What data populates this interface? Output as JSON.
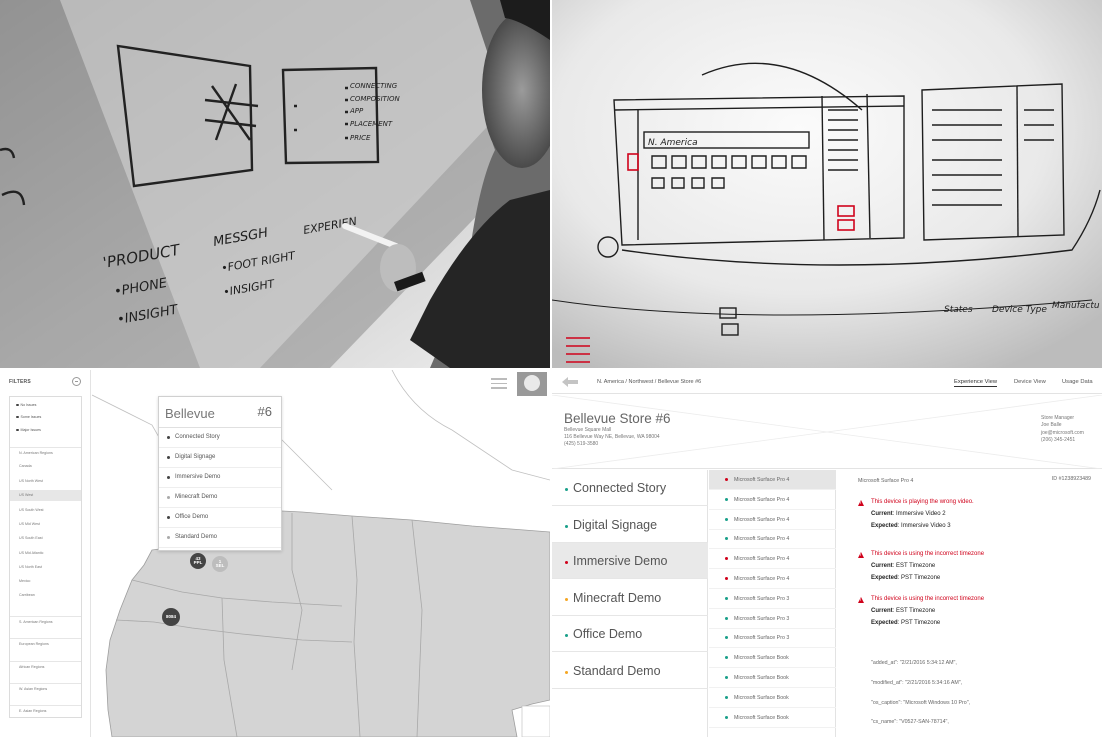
{
  "colors": {
    "alert_red": "#d0021b",
    "teal_bullet": "#1aa08a",
    "red_bullet": "#d0021b",
    "orange_bullet": "#f5a623",
    "marker_dark": "#444444",
    "marker_light": "#bdbdbd",
    "map_fill": "#d4d4d4"
  },
  "map_panel": {
    "filters": {
      "title": "FILTERS",
      "items": [
        {
          "label": "No Issues",
          "kind": "top"
        },
        {
          "label": "Some Issues",
          "kind": "top"
        },
        {
          "label": "Major Issues",
          "kind": "top"
        },
        {
          "label": "N. American Regions",
          "kind": "group"
        },
        {
          "label": "Canada",
          "kind": "sub"
        },
        {
          "label": "US North West",
          "kind": "sub"
        },
        {
          "label": "US West",
          "kind": "sub",
          "selected": true
        },
        {
          "label": "US South West",
          "kind": "sub"
        },
        {
          "label": "US Mid West",
          "kind": "sub"
        },
        {
          "label": "US South East",
          "kind": "sub"
        },
        {
          "label": "US Mid Atlantic",
          "kind": "sub"
        },
        {
          "label": "US North East",
          "kind": "sub"
        },
        {
          "label": "Mexico",
          "kind": "sub"
        },
        {
          "label": "Carribean",
          "kind": "sub"
        },
        {
          "label": "S. American Regions",
          "kind": "group"
        },
        {
          "label": "European Regions",
          "kind": "group"
        },
        {
          "label": "African Regions",
          "kind": "group"
        },
        {
          "label": "W. Asian Regions",
          "kind": "group"
        },
        {
          "label": "E. Asian Regions",
          "kind": "group"
        }
      ]
    },
    "popup": {
      "title": "Bellevue",
      "number": "#6",
      "items": [
        {
          "label": "Connected Story",
          "light": false
        },
        {
          "label": "Digital Signage",
          "light": false
        },
        {
          "label": "Immersive Demo",
          "light": false
        },
        {
          "label": "Minecraft Demo",
          "light": true
        },
        {
          "label": "Office Demo",
          "light": false
        },
        {
          "label": "Standard Demo",
          "light": true
        }
      ]
    },
    "markers": [
      {
        "line1": "43",
        "line2": "PPL",
        "style": "dark"
      },
      {
        "line1": "1",
        "line2": "SEL",
        "style": "light"
      },
      {
        "line1": "8084",
        "line2": "",
        "style": "dark"
      }
    ]
  },
  "detail_panel": {
    "breadcrumb": "N. America / Northwest / Bellevue Store #6",
    "tabs": [
      "Experience View",
      "Device View",
      "Usage Data"
    ],
    "store": {
      "title": "Bellevue Store #6",
      "address_lines": [
        "Bellevue Square Mall",
        "116 Bellevue Way NE, Bellevue, WA 98004",
        "(425) 519-3580"
      ],
      "manager_lines": [
        "Store Manager",
        "Joe Balle",
        "joe@microsoft.com",
        "(206) 345-2451"
      ]
    },
    "experiences": [
      {
        "label": "Connected Story",
        "bullet": "teal"
      },
      {
        "label": "Digital Signage",
        "bullet": "teal"
      },
      {
        "label": "Immersive Demo",
        "bullet": "red",
        "selected": true
      },
      {
        "label": "Minecraft Demo",
        "bullet": "orange"
      },
      {
        "label": "Office Demo",
        "bullet": "teal"
      },
      {
        "label": "Standard Demo",
        "bullet": "orange"
      }
    ],
    "devices": [
      {
        "label": "Microsoft Surface Pro 4",
        "bullet": "red",
        "selected": true
      },
      {
        "label": "Microsoft Surface Pro 4",
        "bullet": "teal"
      },
      {
        "label": "Microsoft Surface Pro 4",
        "bullet": "teal"
      },
      {
        "label": "Microsoft Surface Pro 4",
        "bullet": "teal"
      },
      {
        "label": "Microsoft Surface Pro 4",
        "bullet": "red"
      },
      {
        "label": "Microsoft Surface Pro 4",
        "bullet": "red"
      },
      {
        "label": "Microsoft Surface Pro 3",
        "bullet": "teal"
      },
      {
        "label": "Microsoft Surface Pro 3",
        "bullet": "teal"
      },
      {
        "label": "Microsoft Surface Pro 3",
        "bullet": "teal"
      },
      {
        "label": "Microsoft Surface Book",
        "bullet": "teal"
      },
      {
        "label": "Microsoft Surface Book",
        "bullet": "teal"
      },
      {
        "label": "Microsoft Surface Book",
        "bullet": "teal"
      },
      {
        "label": "Microsoft Surface Book",
        "bullet": "teal"
      }
    ],
    "device_detail": {
      "name": "Microsoft Surface Pro 4",
      "id": "ID #1238923489",
      "issues": [
        {
          "title": "This device is playing the wrong video.",
          "current_label": "Current",
          "current": ": Immersive Video 2",
          "expected_label": "Expected",
          "expected": ": Immersive Video 3"
        },
        {
          "title": "This device is using the incorrect timezone",
          "current_label": "Current",
          "current": ": EST Timezone",
          "expected_label": "Expected",
          "expected": ": PST Timezone"
        },
        {
          "title": "This device is using the incorrect timezone",
          "current_label": "Current",
          "current": ": EST Timezone",
          "expected_label": "Expected",
          "expected": ": PST Timezone"
        }
      ],
      "json_lines": [
        "\"added_at\": \"2/21/2016 5:34:12 AM\",",
        "\"modified_at\": \"2/21/2016 5:34:16 AM\",",
        "\"os_caption\": \"Microsoft Windows 10 Pro\",",
        "\"cs_name\": \"V0527-SAN-78714\","
      ]
    }
  },
  "whiteboard_left": {
    "list_words": [
      "CONNECTING",
      "COMPOSITION",
      "APP",
      "PLACEMENT",
      "PRICE"
    ],
    "product_words": [
      "'PRODUCT",
      "•PHONE",
      "•INSIGHT"
    ],
    "message_words": [
      "MESSGH",
      "•FOOT RIGHT",
      "•INSIGHT"
    ],
    "experience_word": "EXPERIEN"
  },
  "whiteboard_right": {
    "region_label": "N. America",
    "bottom_words": [
      "States",
      "Device Type",
      "Manufactu"
    ]
  }
}
